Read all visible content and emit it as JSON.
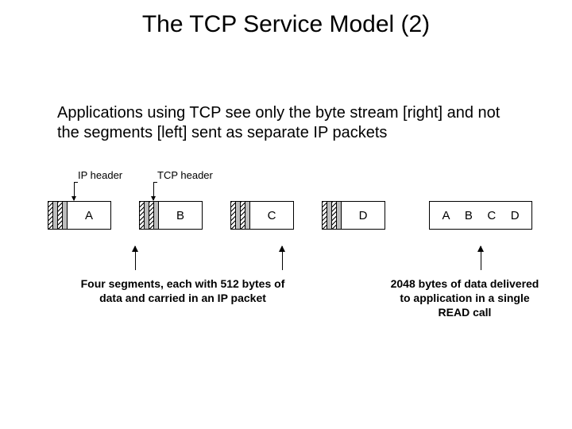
{
  "title": "The TCP Service Model (2)",
  "subtitle": "Applications using TCP see only the byte stream [right] and not the segments [left] sent as separate IP packets",
  "labels": {
    "ip_header": "IP header",
    "tcp_header": "TCP header"
  },
  "segments": [
    "A",
    "B",
    "C",
    "D"
  ],
  "merged": [
    "A",
    "B",
    "C",
    "D"
  ],
  "captions": {
    "left": "Four segments, each with 512 bytes of data and carried in an IP packet",
    "right": "2048 bytes of data delivered to application in a single READ call"
  }
}
